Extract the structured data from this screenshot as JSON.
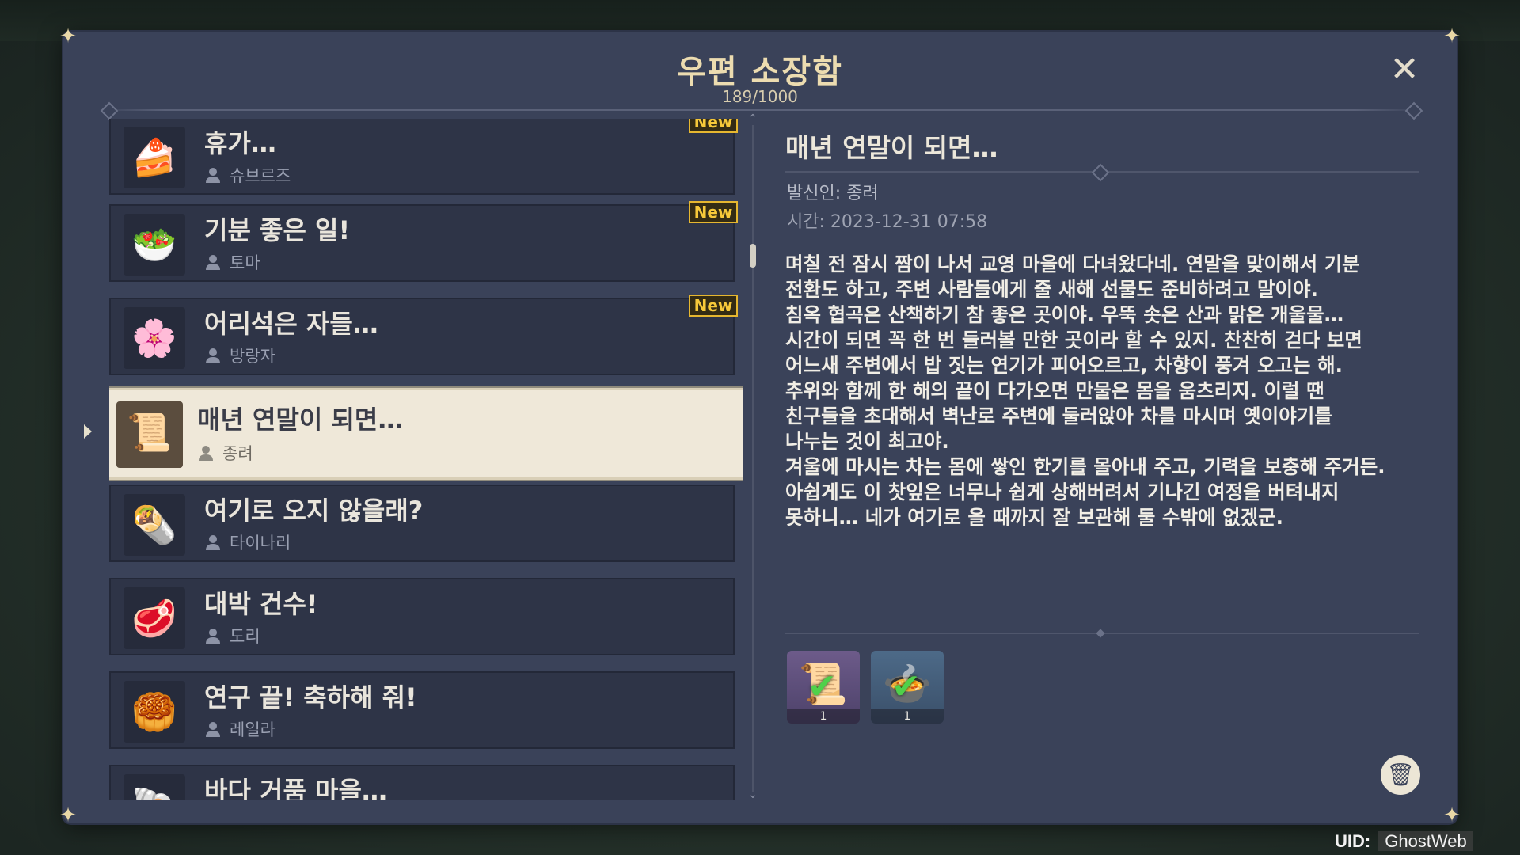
{
  "header": {
    "title": "우편 소장함",
    "count": "189/1000",
    "close_icon": "close-icon"
  },
  "mail_list": [
    {
      "subject": "휴가…",
      "sender": "슈브르즈",
      "badge": "New",
      "icon": "blue-cake-icon"
    },
    {
      "subject": "기분 좋은 일!",
      "sender": "토마",
      "badge": "New",
      "icon": "salad-dish-icon"
    },
    {
      "subject": "어리석은 자들…",
      "sender": "방랑자",
      "badge": "New",
      "icon": "flower-icon"
    },
    {
      "subject": "매년 연말이 되면…",
      "sender": "종려",
      "badge": "",
      "icon": "tea-leaves-icon",
      "selected": true
    },
    {
      "subject": "여기로 오지 않을래?",
      "sender": "타이나리",
      "badge": "",
      "icon": "wrap-dish-icon"
    },
    {
      "subject": "대박 건수!",
      "sender": "도리",
      "badge": "",
      "icon": "meat-icon"
    },
    {
      "subject": "연구 끝! 축하해 줘!",
      "sender": "레일라",
      "badge": "",
      "icon": "pastry-dish-icon"
    },
    {
      "subject": "바다 거품 마을…",
      "sender": "",
      "badge": "",
      "icon": "sea-creature-icon"
    }
  ],
  "detail": {
    "subject": "매년 연말이 되면…",
    "sender": "발신인: 종려",
    "time": "시간: 2023-12-31 07:58",
    "body": [
      "며칠 전 잠시 짬이 나서 교영 마을에 다녀왔다네. 연말을 맞이해서 기분",
      "전환도 하고, 주변 사람들에게 줄 새해 선물도 준비하려고 말이야.",
      "침옥 협곡은 산책하기 참 좋은 곳이야. 우뚝 솟은 산과 맑은 개울물…",
      "시간이 되면 꼭 한 번 들러볼 만한 곳이라 할 수 있지. 찬찬히 걷다 보면",
      "어느새 주변에서 밥 짓는 연기가 피어오르고, 차향이 풍겨 오고는 해.",
      "추위와 함께 한 해의 끝이 다가오면 만물은 몸을 움츠리지. 이럴 땐",
      "친구들을 초대해서 벽난로 주변에 둘러앉아 차를 마시며 옛이야기를",
      "나누는 것이 최고야.",
      "겨울에 마시는 차는 몸에 쌓인 한기를 몰아내 주고, 기력을 보충해 주거든.",
      "아쉽게도 이 찻잎은 너무나 쉽게 상해버려서 기나긴 여정을 버텨내지",
      "못하니… 네가 여기로 올 때까지 잘 보관해 둘 수밖에 없겠군."
    ],
    "attachments": [
      {
        "icon": "tea-leaves-icon",
        "qty": "1",
        "claimed": true
      },
      {
        "icon": "stew-pot-icon",
        "qty": "1",
        "claimed": true
      }
    ],
    "trash_icon": "trash-icon"
  },
  "uid": {
    "label": "UID:",
    "value": "GhostWeb"
  }
}
